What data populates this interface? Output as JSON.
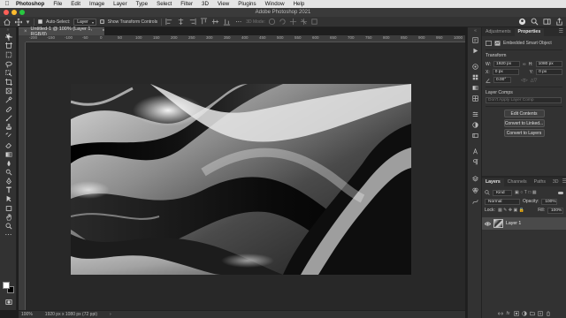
{
  "os_menu": {
    "app_name": "Photoshop",
    "items": [
      "File",
      "Edit",
      "Image",
      "Layer",
      "Type",
      "Select",
      "Filter",
      "3D",
      "View",
      "Plugins",
      "Window",
      "Help"
    ]
  },
  "window": {
    "title": "Adobe Photoshop 2021",
    "traffic_light_colors": [
      "#ff5f57",
      "#febc2e",
      "#28c840"
    ]
  },
  "options_bar": {
    "auto_select_label": "Auto-Select:",
    "auto_select_checked": true,
    "auto_select_target": "Layer",
    "show_transform_label": "Show Transform Controls",
    "show_transform_checked": false,
    "mode_3d_label": "3D Mode:"
  },
  "document": {
    "tab_title": "Untitled-1 @ 100% (Layer 1, RGB/8)",
    "tab_modified_marker": "*",
    "ruler_ticks": [
      "-200",
      "-150",
      "-100",
      "-50",
      "0",
      "50",
      "100",
      "150",
      "200",
      "250",
      "300",
      "350",
      "400",
      "450",
      "500",
      "550",
      "600",
      "650",
      "700",
      "750",
      "800",
      "850",
      "900",
      "950",
      "1000"
    ]
  },
  "status_bar": {
    "zoom": "100%",
    "doc_info": "1920 px x 1080 px (72 ppi)"
  },
  "properties_panel": {
    "tabs": [
      "Adjustments",
      "Properties"
    ],
    "active_tab": "Properties",
    "object_type": "Embedded Smart Object",
    "transform_label": "Transform",
    "w_label": "W:",
    "w_value": "1920 px",
    "h_label": "H:",
    "h_value": "1080 px",
    "x_label": "X:",
    "x_value": "0 px",
    "y_label": "Y:",
    "y_value": "0 px",
    "angle_value": "0.00°",
    "layer_comps_label": "Layer Comps",
    "layer_comps_placeholder": "Don't Apply Layer Comp",
    "buttons": [
      "Edit Contents",
      "Convert to Linked...",
      "Convert to Layers"
    ]
  },
  "layers_panel": {
    "tabs": [
      "Layers",
      "Channels",
      "Paths",
      "3D"
    ],
    "active_tab": "Layers",
    "filter_kind": "Kind",
    "blend_mode": "Normal",
    "opacity_label": "Opacity:",
    "opacity_value": "100%",
    "lock_label": "Lock:",
    "fill_label": "Fill:",
    "fill_value": "100%",
    "layers": [
      {
        "name": "Layer 1",
        "visible": true,
        "smart_object": true
      }
    ]
  },
  "colors": {
    "ui_dark": "#323232",
    "pasteboard": "#282828",
    "foreground": "#ffffff",
    "background": "#000000"
  }
}
